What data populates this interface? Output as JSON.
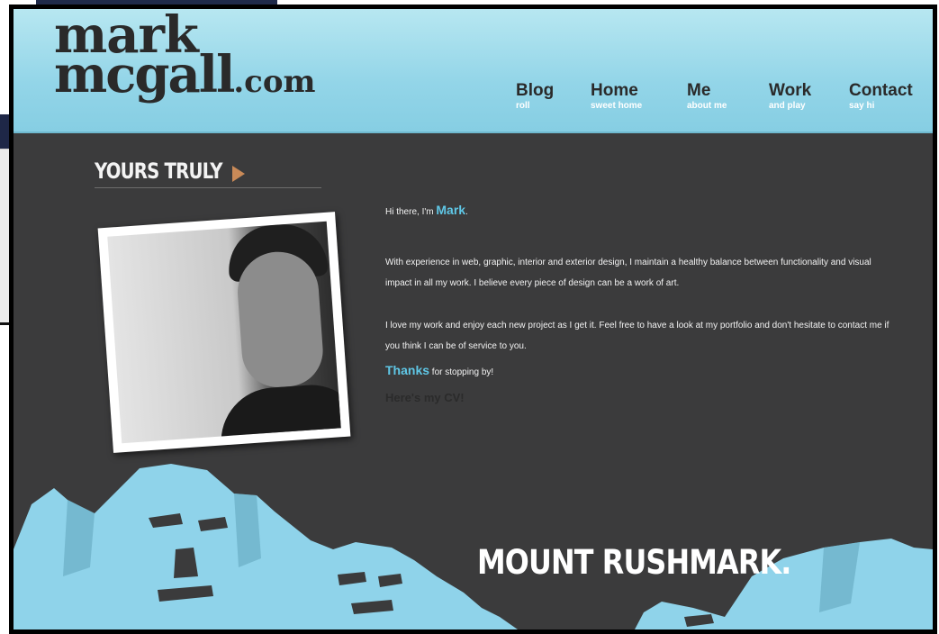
{
  "site": {
    "logo_line1": "mark",
    "logo_line2": "mcgall",
    "logo_tld": ".com"
  },
  "nav": [
    {
      "label": "Blog",
      "sub": "roll"
    },
    {
      "label": "Home",
      "sub": "sweet home"
    },
    {
      "label": "Me",
      "sub": "about me"
    },
    {
      "label": "Work",
      "sub": "and play"
    },
    {
      "label": "Contact",
      "sub": "say hi"
    }
  ],
  "section": {
    "heading": "YOURS TRULY"
  },
  "intro": {
    "hi_prefix": "Hi there, I'm ",
    "name": "Mark",
    "hi_suffix": ".",
    "para1": "With experience in web, graphic, interior and exterior design, I maintain a healthy balance between functionality and visual impact in all my work. I believe every piece of design can be a work of art.",
    "para2": "I love my work and enjoy each new project as I get it. Feel free to have a look at my portfolio and don't hesitate to contact me if you think I can be of service to you.",
    "thanks_word": "Thanks",
    "thanks_rest": " for stopping by!",
    "cv_link": "Here's my CV!"
  },
  "footer": {
    "caption": "MOUNT RUSHMARK."
  },
  "colors": {
    "header_bg": "#93d5e8",
    "page_bg": "#3b3b3c",
    "accent": "#5fc7e6",
    "arrow": "#c98a58",
    "mountain": "#8fd3ea"
  }
}
